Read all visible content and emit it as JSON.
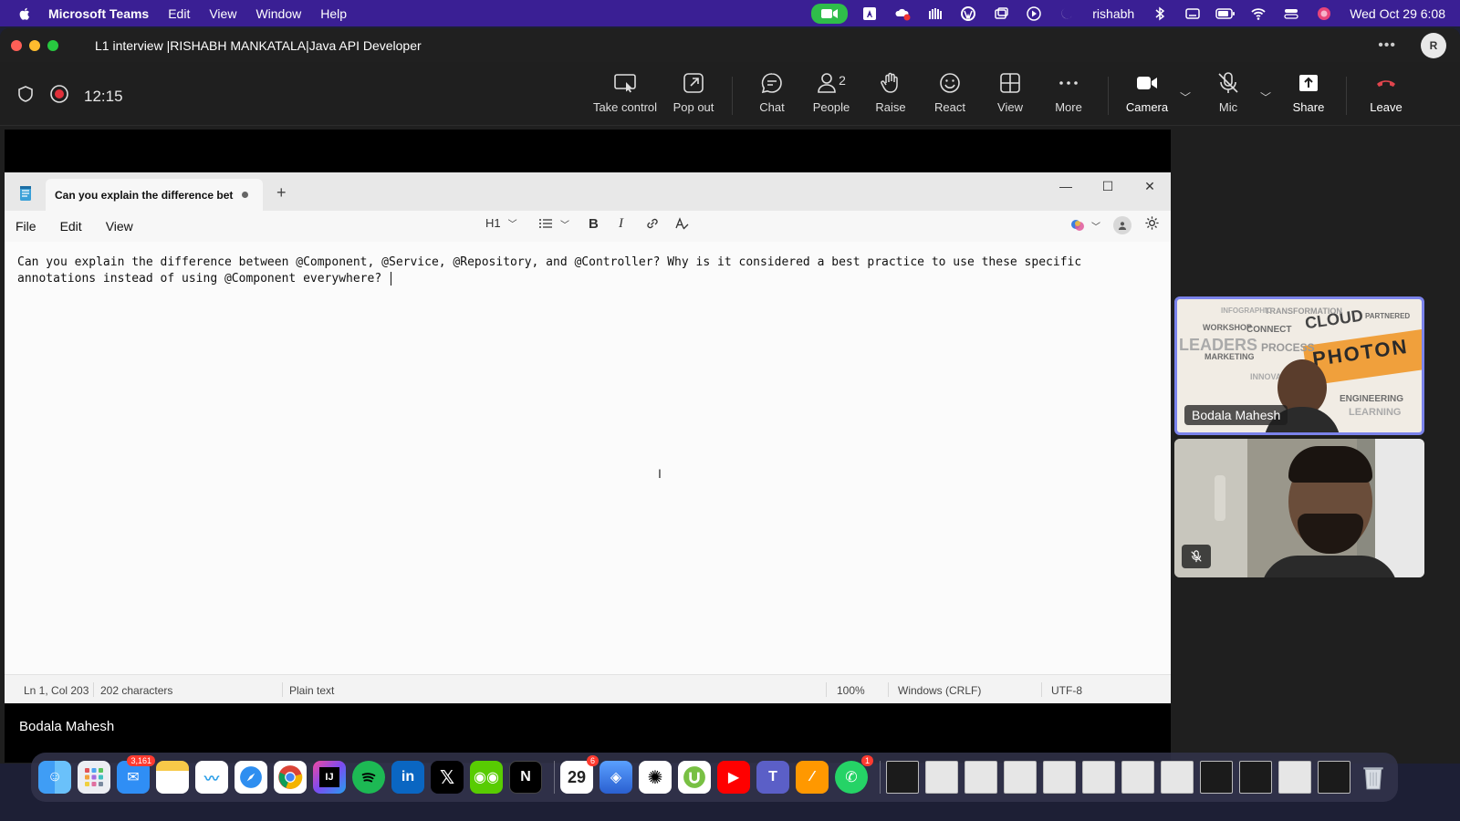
{
  "menubar": {
    "app_name": "Microsoft Teams",
    "menus": [
      "Edit",
      "View",
      "Window",
      "Help"
    ],
    "user": "rishabh",
    "datetime": "Wed Oct 29  6:08"
  },
  "window": {
    "title": "L1 interview |RISHABH MANKATALA|Java API Developer",
    "avatar_initial": "R"
  },
  "meeting": {
    "timer": "12:15",
    "people_count": "2",
    "buttons": {
      "take_control": "Take control",
      "pop_out": "Pop out",
      "chat": "Chat",
      "people": "People",
      "raise": "Raise",
      "react": "React",
      "view": "View",
      "more": "More",
      "camera": "Camera",
      "mic": "Mic",
      "share": "Share",
      "leave": "Leave"
    },
    "presenter_name": "Bodala Mahesh"
  },
  "notepad": {
    "tab_title": "Can you explain the difference bet",
    "menus": [
      "File",
      "Edit",
      "View"
    ],
    "heading_select": "H1",
    "content": "Can you explain the difference between @Component, @Service, @Repository, and @Controller? Why is it considered a best practice to use these specific\nannotations instead of using @Component everywhere? ",
    "status": {
      "position": "Ln 1, Col 203",
      "characters": "202 characters",
      "format": "Plain text",
      "zoom": "100%",
      "line_ending": "Windows (CRLF)",
      "encoding": "UTF-8"
    }
  },
  "participants": {
    "tile1_name": "Bodala Mahesh",
    "wordcloud_words": [
      "CLOUD",
      "PHOTON",
      "CONNECT",
      "PROCESS",
      "TRANSFORMATION",
      "WORKSHOP",
      "LEADERS",
      "MARKETING",
      "ENGINEERING",
      "PARTNERED",
      "INFOGRAPHIC",
      "INNOVATION",
      "LEARNING"
    ]
  },
  "dock": {
    "mail_badge": "3,161",
    "calendar_day": "29",
    "calendar_badge": "6",
    "whatsapp_badge": "1",
    "apps": [
      "Finder",
      "Launchpad",
      "Mail",
      "Notes",
      "Freeform",
      "Safari",
      "Chrome",
      "IntelliJ",
      "Spotify",
      "LinkedIn",
      "X",
      "Duolingo",
      "Notion",
      "Calendar",
      "Copilot",
      "ChatGPT",
      "uTorrent",
      "YouTube",
      "Teams",
      "Sublime",
      "WhatsApp"
    ]
  }
}
